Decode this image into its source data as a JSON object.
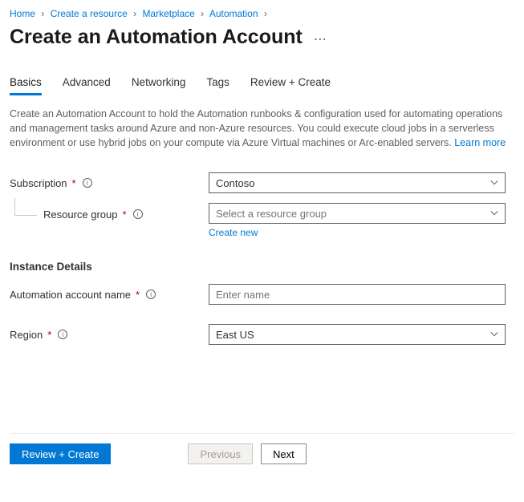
{
  "breadcrumb": [
    {
      "label": "Home"
    },
    {
      "label": "Create a resource"
    },
    {
      "label": "Marketplace"
    },
    {
      "label": "Automation"
    }
  ],
  "title": "Create an Automation Account",
  "tabs": [
    {
      "label": "Basics",
      "active": true
    },
    {
      "label": "Advanced"
    },
    {
      "label": "Networking"
    },
    {
      "label": "Tags"
    },
    {
      "label": "Review + Create"
    }
  ],
  "description": "Create an Automation Account to hold the Automation runbooks & configuration used for automating operations and management tasks around Azure and non-Azure resources. You could execute cloud jobs in a serverless environment or use hybrid jobs on your compute via Azure Virtual machines or Arc-enabled servers.",
  "learn_more": "Learn more",
  "fields": {
    "subscription": {
      "label": "Subscription",
      "value": "Contoso"
    },
    "resource_group": {
      "label": "Resource group",
      "placeholder": "Select a resource group",
      "create_new": "Create new"
    },
    "instance_heading": "Instance Details",
    "account_name": {
      "label": "Automation account name",
      "placeholder": "Enter name"
    },
    "region": {
      "label": "Region",
      "value": "East US"
    }
  },
  "footer": {
    "review": "Review + Create",
    "previous": "Previous",
    "next": "Next"
  }
}
